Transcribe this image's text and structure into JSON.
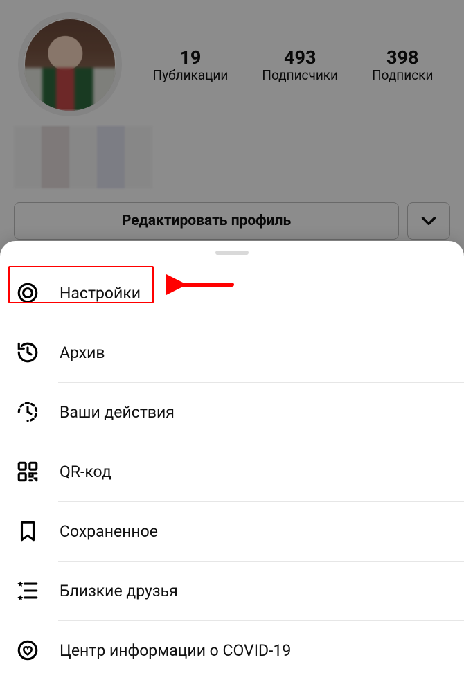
{
  "profile": {
    "stats": {
      "posts_count": "19",
      "posts_label": "Публикации",
      "followers_count": "493",
      "followers_label": "Подписчики",
      "following_count": "398",
      "following_label": "Подписки"
    },
    "edit_button": "Редактировать профиль"
  },
  "menu": {
    "items": [
      {
        "id": "settings",
        "label": "Настройки"
      },
      {
        "id": "archive",
        "label": "Архив"
      },
      {
        "id": "activity",
        "label": "Ваши действия"
      },
      {
        "id": "qrcode",
        "label": "QR-код"
      },
      {
        "id": "saved",
        "label": "Сохраненное"
      },
      {
        "id": "closefriends",
        "label": "Близкие друзья"
      },
      {
        "id": "covid",
        "label": "Центр информации о COVID-19"
      }
    ]
  },
  "annotation": {
    "highlighted_item": "settings"
  }
}
